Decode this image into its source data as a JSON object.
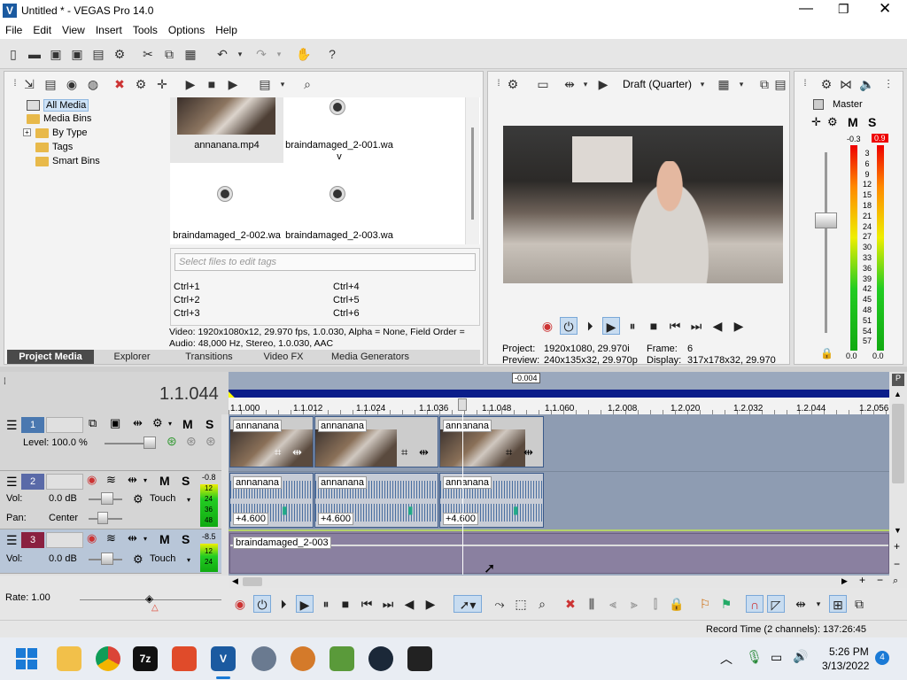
{
  "window": {
    "title": "Untitled * - VEGAS Pro 14.0",
    "app_icon": "vegas-icon"
  },
  "menu": [
    "File",
    "Edit",
    "View",
    "Insert",
    "Tools",
    "Options",
    "Help"
  ],
  "project_media": {
    "tree": [
      "All Media",
      "Media Bins",
      "By Type",
      "Tags",
      "Smart Bins"
    ],
    "tree_expander": "+",
    "files": [
      {
        "name": "annanana.mp4",
        "type": "video"
      },
      {
        "name": "braindamaged_2-001.wa\nv",
        "type": "audio"
      },
      {
        "name": "braindamaged_2-002.wa",
        "type": "audio"
      },
      {
        "name": "braindamaged_2-003.wa",
        "type": "audio"
      }
    ],
    "tags_placeholder": "Select files to edit tags",
    "shortcuts": [
      "Ctrl+1",
      "Ctrl+4",
      "Ctrl+2",
      "Ctrl+5",
      "Ctrl+3",
      "Ctrl+6"
    ],
    "info_video": "Video: 1920x1080x12, 29.970 fps, 1.0.030, Alpha = None, Field Order =",
    "info_audio": "Audio: 48,000 Hz, Stereo, 1.0.030, AAC"
  },
  "tabs": [
    {
      "label": "Project Media",
      "active": true
    },
    {
      "label": "Explorer",
      "active": false
    },
    {
      "label": "Transitions",
      "active": false
    },
    {
      "label": "Video FX",
      "active": false
    },
    {
      "label": "Media Generators",
      "active": false
    }
  ],
  "preview": {
    "quality": "Draft (Quarter)",
    "project_label": "Project:",
    "project_value": "1920x1080, 29.970i",
    "preview_label": "Preview:",
    "preview_value": "240x135x32, 29.970p",
    "frame_label": "Frame:",
    "frame_value": "6",
    "display_label": "Display:",
    "display_value": "317x178x32, 29.970"
  },
  "master": {
    "title": "Master",
    "m_label": "M",
    "s_label": "S",
    "peak_left": "-0.3",
    "peak_right": "0.9",
    "scale": [
      "3",
      "6",
      "9",
      "12",
      "15",
      "18",
      "21",
      "24",
      "27",
      "30",
      "33",
      "36",
      "39",
      "42",
      "45",
      "48",
      "51",
      "54",
      "57"
    ],
    "bottom_left": "0.0",
    "bottom_right": "0.0"
  },
  "timeline": {
    "timecode": "1.1.044",
    "cursor_offset": "-0.004",
    "ruler": [
      "1.1.000",
      "1.1.012",
      "1.1.024",
      "1.1.036",
      "1.1.048",
      "1.1.060",
      "1.2.008",
      "1.2.020",
      "1.2.032",
      "1.2.044",
      "1.2.056"
    ],
    "rate_label": "Rate: 1.00",
    "record_time": "Record Time (2 channels): 137:26:45"
  },
  "tracks": [
    {
      "number": "1",
      "kind": "video",
      "level": "Level: 100.0 %",
      "m": "M",
      "s": "S"
    },
    {
      "number": "2",
      "kind": "audio",
      "vol_label": "Vol:",
      "vol": "0.0 dB",
      "pan_label": "Pan:",
      "pan": "Center",
      "fx": "Touch",
      "m": "M",
      "s": "S",
      "meter_peak": "-0.8",
      "meter_marks": [
        "12",
        "24",
        "36",
        "48"
      ]
    },
    {
      "number": "3",
      "kind": "audio",
      "vol_label": "Vol:",
      "vol": "0.0 dB",
      "fx": "Touch",
      "m": "M",
      "s": "S",
      "meter_peak": "-8.5",
      "meter_marks": [
        "12",
        "24"
      ]
    }
  ],
  "clips": {
    "video": [
      "annanana",
      "annanana",
      "annanana"
    ],
    "audio": [
      "annanana",
      "annanana",
      "annanana"
    ],
    "audio_gain": [
      "+4.600",
      "+4.600",
      "+4.600"
    ],
    "track3": "braindamaged_2-003"
  },
  "taskbar": {
    "time": "5:26 PM",
    "date": "3/13/2022",
    "notification_count": "4",
    "seven_zip": "7z"
  }
}
